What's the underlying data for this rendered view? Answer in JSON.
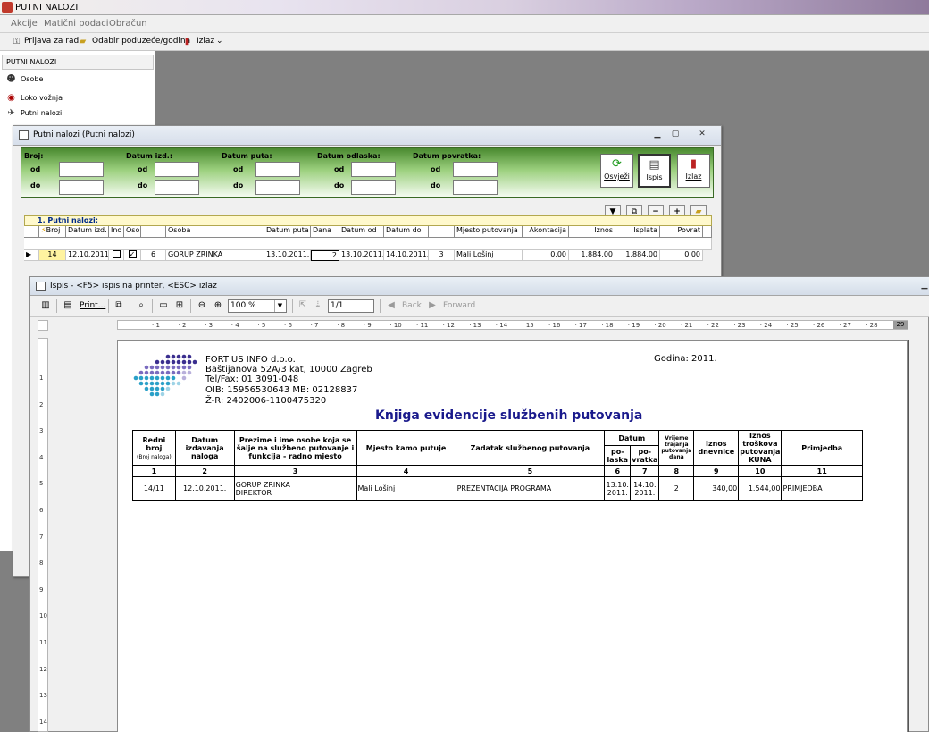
{
  "app": {
    "title": "PUTNI NALOZI",
    "menu": [
      "Akcije",
      "Matični podaci",
      "Obračun"
    ],
    "toolbar": {
      "login": "Prijava za rad",
      "company": "Odabir poduzeće/godina",
      "exit": "Izlaz",
      "more": "⌄"
    }
  },
  "sidebar": {
    "header": "PUTNI NALOZI",
    "items": [
      "Osobe",
      "Loko vožnja",
      "Putni nalozi"
    ]
  },
  "putni_window": {
    "title": "Putni nalozi  (Putni nalozi)",
    "filters": {
      "broj": "Broj:",
      "datum_izd": "Datum izd.:",
      "datum_puta": "Datum puta:",
      "datum_odlaska": "Datum odlaska:",
      "datum_povratka": "Datum povratka:",
      "od": "od",
      "do": "do"
    },
    "buttons": {
      "refresh": "Osvježi",
      "print": "Ispis",
      "exit": "Izlaz"
    },
    "grid_title": "1. Putni nalozi:",
    "columns": [
      "Broj",
      "Datum izd.",
      "Ino",
      "Oso",
      "",
      "Osoba",
      "Datum puta",
      "Dana",
      "Datum od",
      "Datum do",
      "",
      "Mjesto putovanja",
      "Akontacija",
      "Iznos",
      "Isplata",
      "Povrat"
    ],
    "row": {
      "broj": "14",
      "datum_izd": "12.10.2011.",
      "ino": false,
      "oso": true,
      "oso_check": "✓",
      "num": "6",
      "osoba": "GORUP ZRINKA",
      "datum_puta": "13.10.2011.",
      "dana": "2",
      "datum_od": "13.10.2011.",
      "datum_do": "14.10.2011.",
      "n3": "3",
      "mjesto": "Mali Lošinj",
      "akontacija": "0,00",
      "iznos": "1.884,00",
      "isplata": "1.884,00",
      "povrat": "0,00"
    }
  },
  "ispis_window": {
    "title": "Ispis - <F5> ispis na printer, <ESC> izlaz",
    "toolbar": {
      "print": "Print...",
      "zoom": "100 %",
      "page": "1/1",
      "back": "Back",
      "forward": "Forward"
    },
    "ruler_end": "29"
  },
  "report": {
    "company": {
      "name": "FORTIUS INFO d.o.o.",
      "address": "Baštijanova 52A/3 kat, 10000 Zagreb",
      "tel": "Tel/Fax: 01 3091-048",
      "oib": "OIB: 15956530643  MB: 02128837",
      "zr": "Ž-R: 2402006-1100475320"
    },
    "godina": "Godina: 2011.",
    "title": "Knjiga evidencije službenih putovanja",
    "headers": {
      "redni": "Redni broj",
      "redni_sub": "(Broj naloga)",
      "datum_izd": "Datum izdavanja naloga",
      "osoba": "Prezime i ime osobe koja se šalje na službeno putovanje i funkcija - radno mjesto",
      "mjesto": "Mjesto kamo putuje",
      "zadatak": "Zadatak službenog putovanja",
      "datum": "Datum",
      "polaska": "po-laska",
      "povratka": "po-vratka",
      "vrijeme": "Vrijeme trajanja putovanja dana",
      "dnevnice": "Iznos dnevnice",
      "troskova": "Iznos troškova putovanja KUNA",
      "primjedba": "Primjedba"
    },
    "col_numbers": [
      "1",
      "2",
      "3",
      "4",
      "5",
      "6",
      "7",
      "8",
      "9",
      "10",
      "11"
    ],
    "row": {
      "redni": "14/11",
      "datum_izd": "12.10.2011.",
      "osoba": "GORUP ZRINKA",
      "funkcija": "DIREKTOR",
      "mjesto": "Mali Lošinj",
      "zadatak": "PREZENTACIJA PROGRAMA",
      "polaska": "13.10. 2011.",
      "povratka": "14.10. 2011.",
      "dana": "2",
      "dnevnice": "340,00",
      "troskovi": "1.544,00",
      "primjedba": "PRIMJEDBA"
    }
  }
}
